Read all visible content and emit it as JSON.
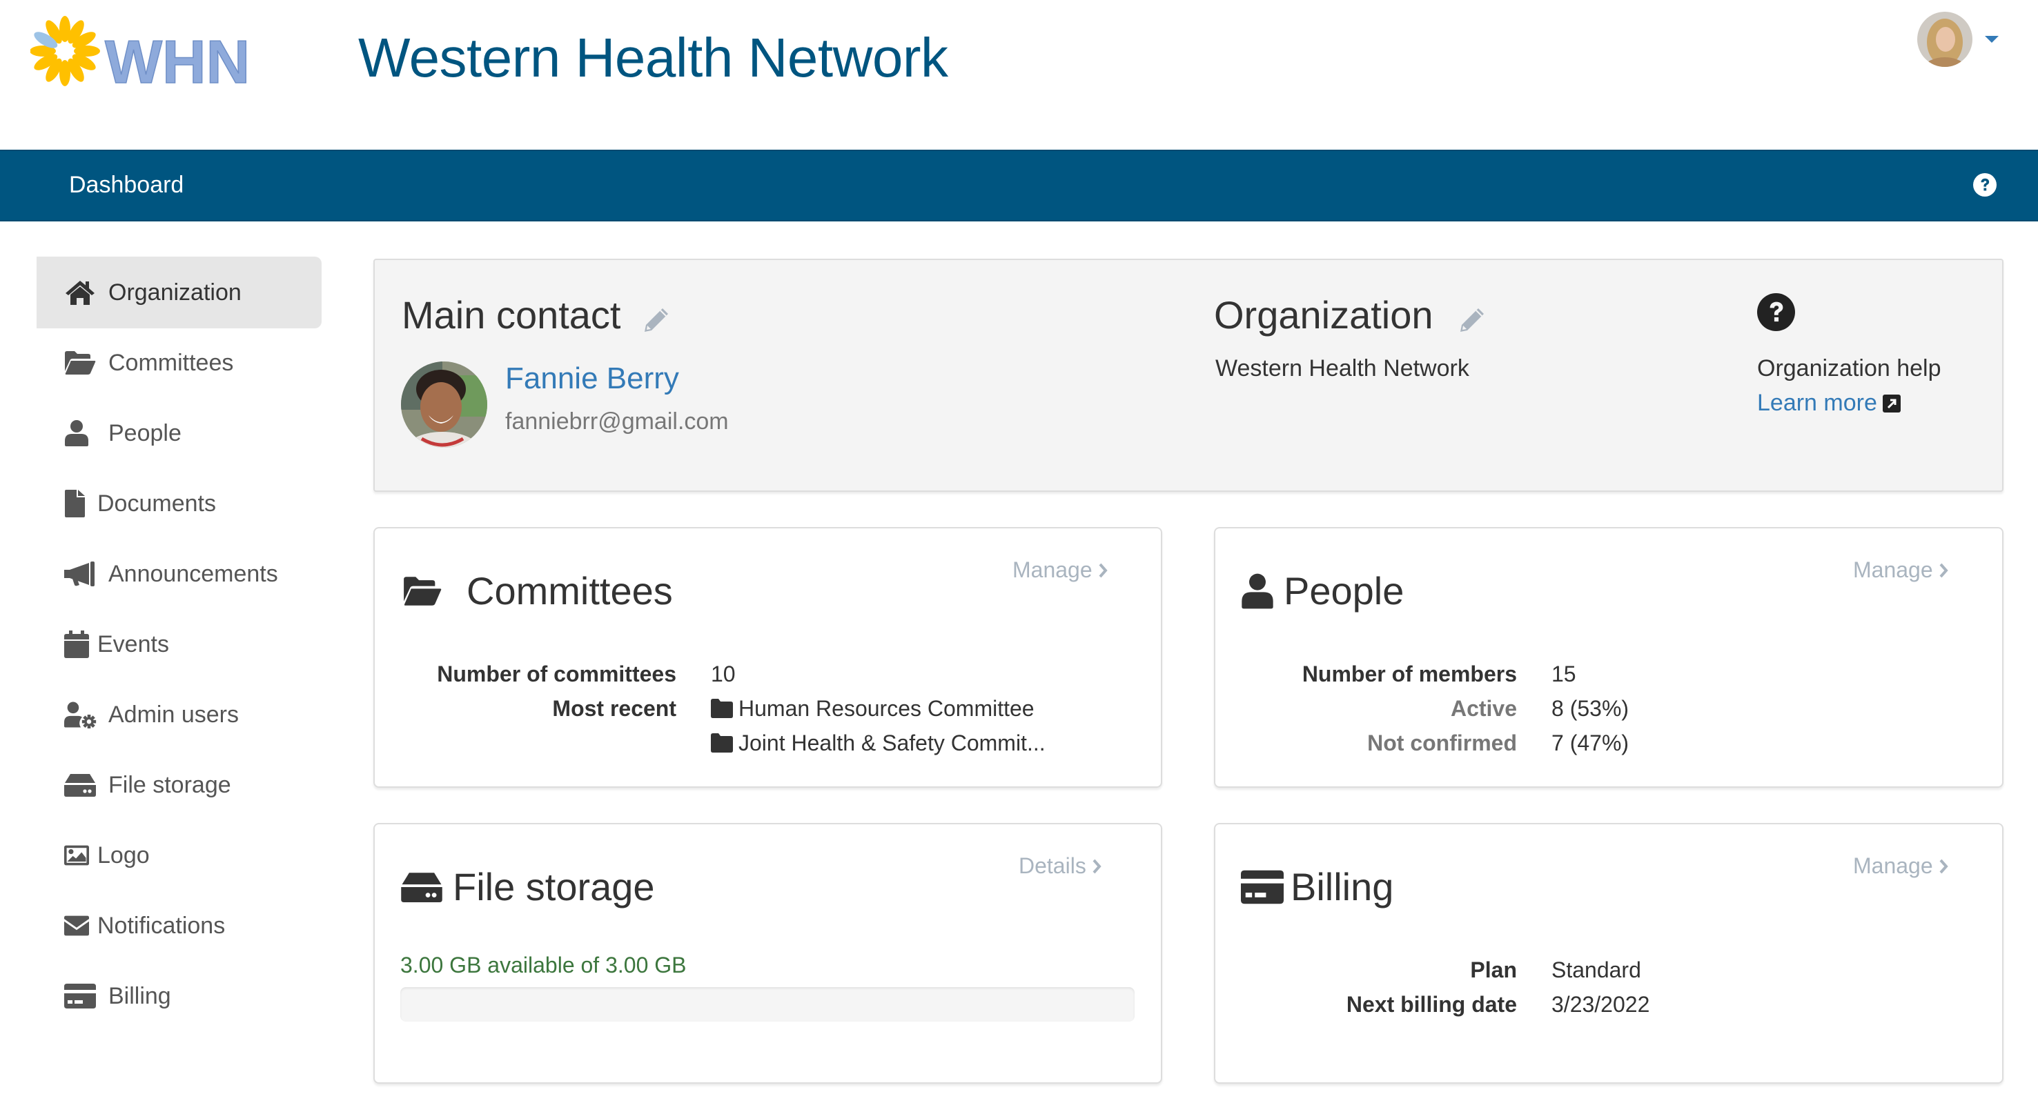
{
  "header": {
    "logo_text": "WHN",
    "title": "Western Health Network",
    "user_menu_icon": "user-avatar"
  },
  "navbar": {
    "title": "Dashboard",
    "help_icon": "question-circle-icon"
  },
  "sidebar": {
    "items": [
      {
        "label": "Organization",
        "icon": "home-icon",
        "active": true
      },
      {
        "label": "Committees",
        "icon": "folder-open-icon",
        "active": false
      },
      {
        "label": "People",
        "icon": "user-icon",
        "active": false
      },
      {
        "label": "Documents",
        "icon": "file-icon",
        "active": false
      },
      {
        "label": "Announcements",
        "icon": "bullhorn-icon",
        "active": false
      },
      {
        "label": "Events",
        "icon": "calendar-icon",
        "active": false
      },
      {
        "label": "Admin users",
        "icon": "user-cog-icon",
        "active": false
      },
      {
        "label": "File storage",
        "icon": "hdd-icon",
        "active": false
      },
      {
        "label": "Logo",
        "icon": "image-icon",
        "active": false
      },
      {
        "label": "Notifications",
        "icon": "envelope-icon",
        "active": false
      },
      {
        "label": "Billing",
        "icon": "credit-card-icon",
        "active": false
      }
    ]
  },
  "overview": {
    "main_contact": {
      "heading": "Main contact",
      "name": "Fannie Berry",
      "email": "fanniebrr@gmail.com"
    },
    "organization": {
      "heading": "Organization",
      "name": "Western Health Network"
    },
    "help": {
      "label": "Organization help",
      "link": "Learn more"
    }
  },
  "committees": {
    "heading": "Committees",
    "action": "Manage",
    "count_label": "Number of committees",
    "count": "10",
    "recent_label": "Most recent",
    "recent": [
      "Human Resources Committee",
      "Joint Health & Safety Commit..."
    ]
  },
  "people": {
    "heading": "People",
    "action": "Manage",
    "rows": [
      {
        "label": "Number of members",
        "value": "15"
      },
      {
        "label": "Active",
        "value": "8 (53%)"
      },
      {
        "label": "Not confirmed",
        "value": "7 (47%)"
      }
    ]
  },
  "file_storage": {
    "heading": "File storage",
    "action": "Details",
    "summary": "3.00 GB available of 3.00 GB",
    "used_fraction": 0
  },
  "billing": {
    "heading": "Billing",
    "action": "Manage",
    "rows": [
      {
        "label": "Plan",
        "value": "Standard"
      },
      {
        "label": "Next billing date",
        "value": "3/23/2022"
      }
    ]
  },
  "colors": {
    "brand_blue": "#005580",
    "link_blue": "#337ab7",
    "muted_link": "#a9b4bf",
    "storage_green": "#3c763d",
    "logo_yellow": "#ffc000",
    "logo_blue": "#8eaadb"
  }
}
